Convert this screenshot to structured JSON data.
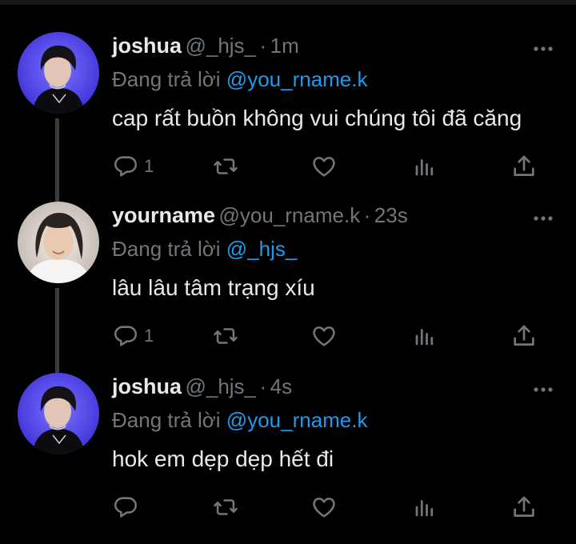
{
  "colors": {
    "background": "#000000",
    "text": "#e7e9ea",
    "muted": "#71767b",
    "link": "#1d9bf0",
    "thread_line": "#3a3d40"
  },
  "tweets": [
    {
      "name": "joshua",
      "handle": "@_hjs_",
      "separator": "·",
      "time": "1m",
      "reply_prefix": "Đang trả lời",
      "reply_to": "@you_rname.k",
      "text": "cap rất buồn không vui chúng tôi đã căng",
      "reply_count": "1",
      "avatar": "joshua-avatar"
    },
    {
      "name": "yourname",
      "handle": "@you_rname.k",
      "separator": "·",
      "time": "23s",
      "reply_prefix": "Đang trả lời",
      "reply_to": "@_hjs_",
      "text": "lâu lâu tâm trạng xíu",
      "reply_count": "1",
      "avatar": "yourname-avatar"
    },
    {
      "name": "joshua",
      "handle": "@_hjs_",
      "separator": "·",
      "time": "4s",
      "reply_prefix": "Đang trả lời",
      "reply_to": "@you_rname.k",
      "text": "hok em dẹp dẹp hết đi",
      "reply_count": "",
      "avatar": "joshua-avatar"
    }
  ],
  "icons": [
    "reply-icon",
    "retweet-icon",
    "like-icon",
    "analytics-icon",
    "share-icon",
    "more-icon"
  ]
}
